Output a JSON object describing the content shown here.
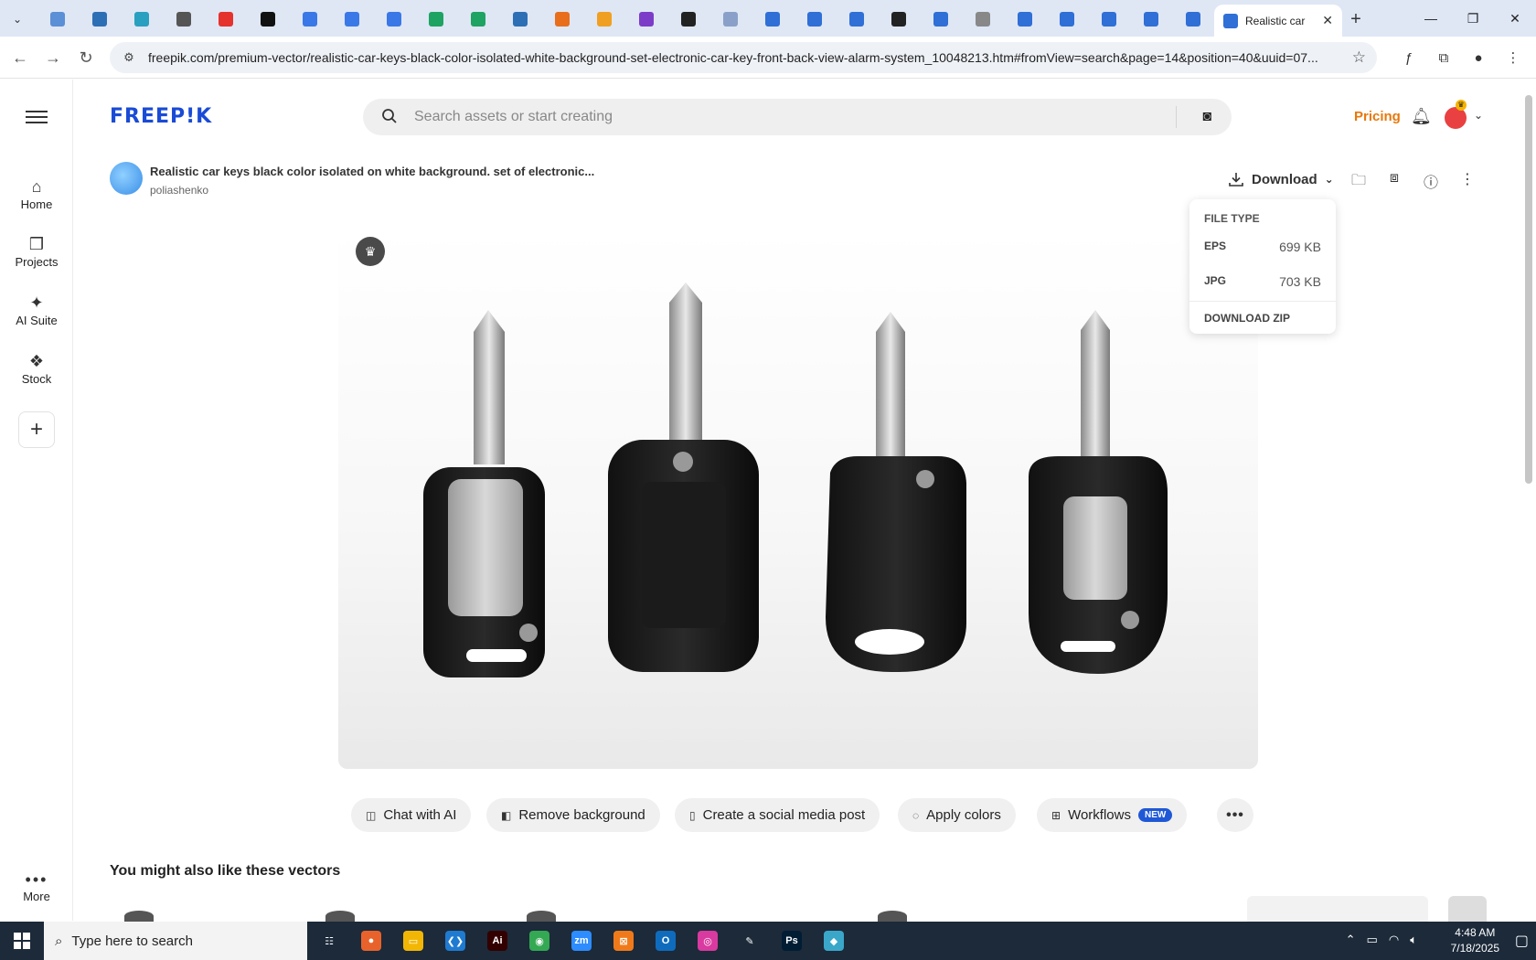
{
  "browser": {
    "active_tab_title": "Realistic car",
    "url": "freepik.com/premium-vector/realistic-car-keys-black-color-isolated-white-background-set-electronic-car-key-front-back-view-alarm-system_10048213.htm#fromView=search&page=14&position=40&uuid=07...",
    "new_tab_label": "+",
    "mini_tab_colors": [
      "#5b8fd6",
      "#2d6fb5",
      "#2aa0c0",
      "#555",
      "#e5322d",
      "#111",
      "#3b78e7",
      "#3b78e7",
      "#3b78e7",
      "#1ea362",
      "#1ea362",
      "#2d6fb5",
      "#e86e1c",
      "#f0a020",
      "#7d3cc8",
      "#222",
      "#8aa0c8",
      "#2f6fd6",
      "#2f6fd6",
      "#2f6fd6",
      "#222",
      "#2f6fd6",
      "#888",
      "#2f6fd6",
      "#2f6fd6",
      "#2f6fd6",
      "#2f6fd6",
      "#2f6fd6"
    ]
  },
  "header": {
    "logo": "FREEP!K",
    "search_placeholder": "Search assets or start creating",
    "pricing": "Pricing"
  },
  "rail": {
    "items": [
      {
        "label": "Home",
        "icon": "home-icon"
      },
      {
        "label": "Projects",
        "icon": "projects-icon"
      },
      {
        "label": "AI Suite",
        "icon": "sparkle-icon"
      },
      {
        "label": "Stock",
        "icon": "stock-icon"
      }
    ],
    "more_label": "More"
  },
  "asset": {
    "title": "Realistic car keys black color isolated on white background. set of electronic...",
    "author": "poliashenko",
    "download_label": "Download"
  },
  "download_menu": {
    "header": "FILE TYPE",
    "files": [
      {
        "type": "EPS",
        "size": "699 KB"
      },
      {
        "type": "JPG",
        "size": "703 KB"
      }
    ],
    "zip_label": "DOWNLOAD ZIP"
  },
  "actions": [
    {
      "label": "Chat with AI",
      "icon": "chat-icon"
    },
    {
      "label": "Remove background",
      "icon": "remove-bg-icon"
    },
    {
      "label": "Create a social media post",
      "icon": "phone-icon"
    },
    {
      "label": "Apply colors",
      "icon": "palette-icon"
    },
    {
      "label": "Workflows",
      "icon": "workflow-icon",
      "badge": "NEW"
    }
  ],
  "related_heading": "You might also like these vectors",
  "taskbar": {
    "search_placeholder": "Type here to search",
    "time": "4:48 AM",
    "date": "7/18/2025",
    "apps": [
      {
        "name": "task-view",
        "color": "#1c2a3a",
        "glyph": "☷"
      },
      {
        "name": "firefox",
        "color": "#e8632b",
        "glyph": "●"
      },
      {
        "name": "file-explorer",
        "color": "#f2b705",
        "glyph": "▭"
      },
      {
        "name": "vscode",
        "color": "#1f7bd0",
        "glyph": "❮❯"
      },
      {
        "name": "illustrator",
        "color": "#330000",
        "glyph": "Ai"
      },
      {
        "name": "chrome",
        "color": "#34a853",
        "glyph": "◉"
      },
      {
        "name": "zoom",
        "color": "#2d8cff",
        "glyph": "zm"
      },
      {
        "name": "xampp",
        "color": "#f07a1a",
        "glyph": "⊠"
      },
      {
        "name": "outlook",
        "color": "#0f6cbd",
        "glyph": "O"
      },
      {
        "name": "creative-cloud",
        "color": "#d93aa0",
        "glyph": "◎"
      },
      {
        "name": "pen-tool",
        "color": "#1c2a3a",
        "glyph": "✎"
      },
      {
        "name": "photoshop",
        "color": "#001d34",
        "glyph": "Ps"
      },
      {
        "name": "app-diamond",
        "color": "#3aa7c9",
        "glyph": "◆"
      }
    ]
  },
  "colors": {
    "brand": "#1a4bd6",
    "pricing": "#e8780c",
    "new_badge": "#1f58d6"
  }
}
